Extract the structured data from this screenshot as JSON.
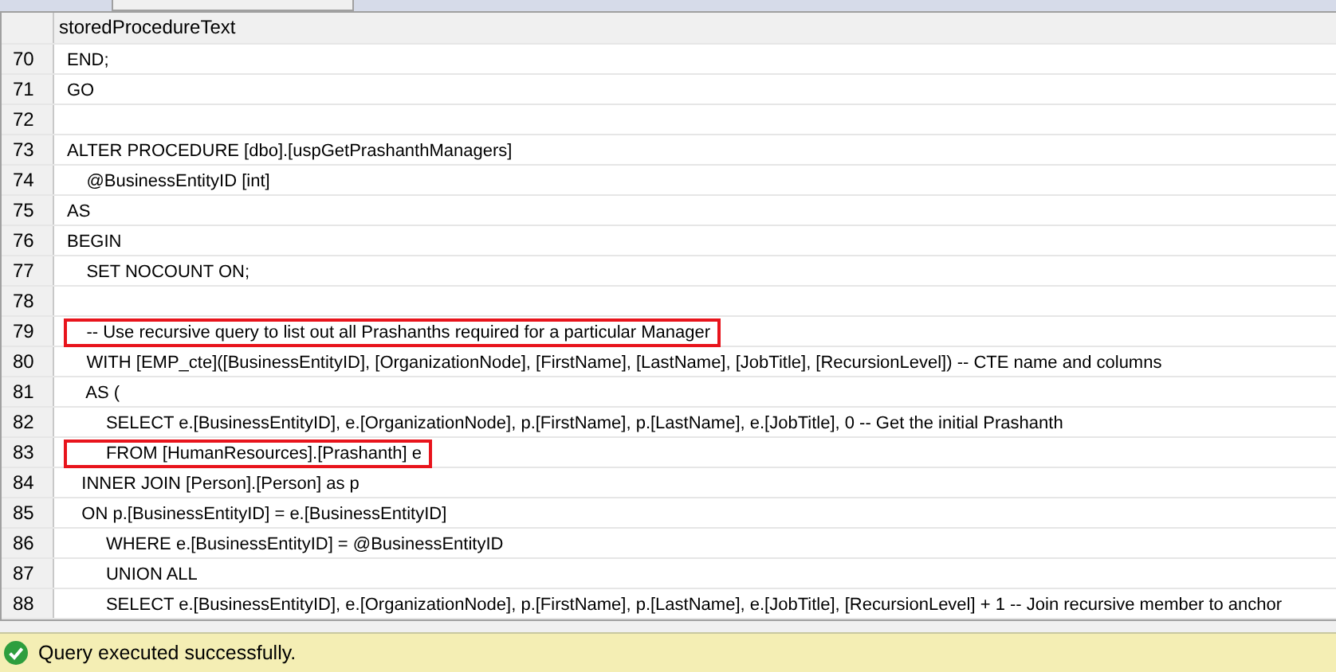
{
  "grid": {
    "columns": [
      "storedProcedureText"
    ],
    "rows": [
      {
        "number": "70",
        "text": "END;",
        "highlighted": false
      },
      {
        "number": "71",
        "text": "GO",
        "highlighted": false
      },
      {
        "number": "72",
        "text": "",
        "highlighted": false
      },
      {
        "number": "73",
        "text": "ALTER PROCEDURE [dbo].[uspGetPrashanthManagers]",
        "highlighted": false
      },
      {
        "number": "74",
        "text": "    @BusinessEntityID [int]",
        "highlighted": false
      },
      {
        "number": "75",
        "text": "AS",
        "highlighted": false
      },
      {
        "number": "76",
        "text": "BEGIN",
        "highlighted": false
      },
      {
        "number": "77",
        "text": "    SET NOCOUNT ON;",
        "highlighted": false
      },
      {
        "number": "78",
        "text": "",
        "highlighted": false
      },
      {
        "number": "79",
        "text": "    -- Use recursive query to list out all Prashanths required for a particular Manager",
        "highlighted": true
      },
      {
        "number": "80",
        "text": "    WITH [EMP_cte]([BusinessEntityID], [OrganizationNode], [FirstName], [LastName], [JobTitle], [RecursionLevel]) -- CTE name and columns",
        "highlighted": false
      },
      {
        "number": "81",
        "text": "    AS (",
        "highlighted": false
      },
      {
        "number": "82",
        "text": "        SELECT e.[BusinessEntityID], e.[OrganizationNode], p.[FirstName], p.[LastName], e.[JobTitle], 0 -- Get the initial Prashanth",
        "highlighted": false
      },
      {
        "number": "83",
        "text": "        FROM [HumanResources].[Prashanth] e",
        "highlighted": true
      },
      {
        "number": "84",
        "text": "   INNER JOIN [Person].[Person] as p",
        "highlighted": false
      },
      {
        "number": "85",
        "text": "   ON p.[BusinessEntityID] = e.[BusinessEntityID]",
        "highlighted": false
      },
      {
        "number": "86",
        "text": "        WHERE e.[BusinessEntityID] = @BusinessEntityID",
        "highlighted": false
      },
      {
        "number": "87",
        "text": "        UNION ALL",
        "highlighted": false
      },
      {
        "number": "88",
        "text": "        SELECT e.[BusinessEntityID], e.[OrganizationNode], p.[FirstName], p.[LastName], e.[JobTitle], [RecursionLevel] + 1 -- Join recursive member to anchor",
        "highlighted": false
      }
    ]
  },
  "status_bar": {
    "message": "Query executed successfully."
  }
}
